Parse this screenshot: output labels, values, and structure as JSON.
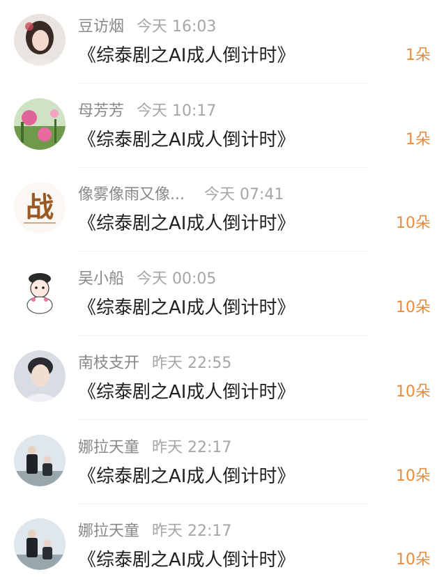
{
  "items": [
    {
      "name": "豆访烟",
      "time": "今天 16:03",
      "gift": "《综泰剧之AI成人倒计时》",
      "count": "1朵",
      "avatar_icon": "girl-portrait-avatar"
    },
    {
      "name": "母芳芳",
      "time": "今天 10:17",
      "gift": "《综泰剧之AI成人倒计时》",
      "count": "1朵",
      "avatar_icon": "pink-flowers-avatar"
    },
    {
      "name": "像雾像雨又像...",
      "time": "今天 07:41",
      "gift": "《综泰剧之AI成人倒计时》",
      "count": "10朵",
      "avatar_icon": "calligraphy-zhan-avatar"
    },
    {
      "name": "吴小船",
      "time": "今天 00:05",
      "gift": "《综泰剧之AI成人倒计时》",
      "count": "10朵",
      "avatar_icon": "cartoon-character-avatar"
    },
    {
      "name": "南枝支开",
      "time": "昨天 22:55",
      "gift": "《综泰剧之AI成人倒计时》",
      "count": "10朵",
      "avatar_icon": "young-man-portrait-avatar"
    },
    {
      "name": "娜拉天童",
      "time": "昨天 22:17",
      "gift": "《综泰剧之AI成人倒计时》",
      "count": "10朵",
      "avatar_icon": "two-people-avatar"
    },
    {
      "name": "娜拉天童",
      "time": "昨天 22:17",
      "gift": "《综泰剧之AI成人倒计时》",
      "count": "10朵",
      "avatar_icon": "two-people-avatar"
    }
  ],
  "avatar_text": {
    "zhan": "战"
  },
  "colors": {
    "count": "#e58d3f",
    "name": "#888888",
    "gift": "#1f1f1f"
  }
}
